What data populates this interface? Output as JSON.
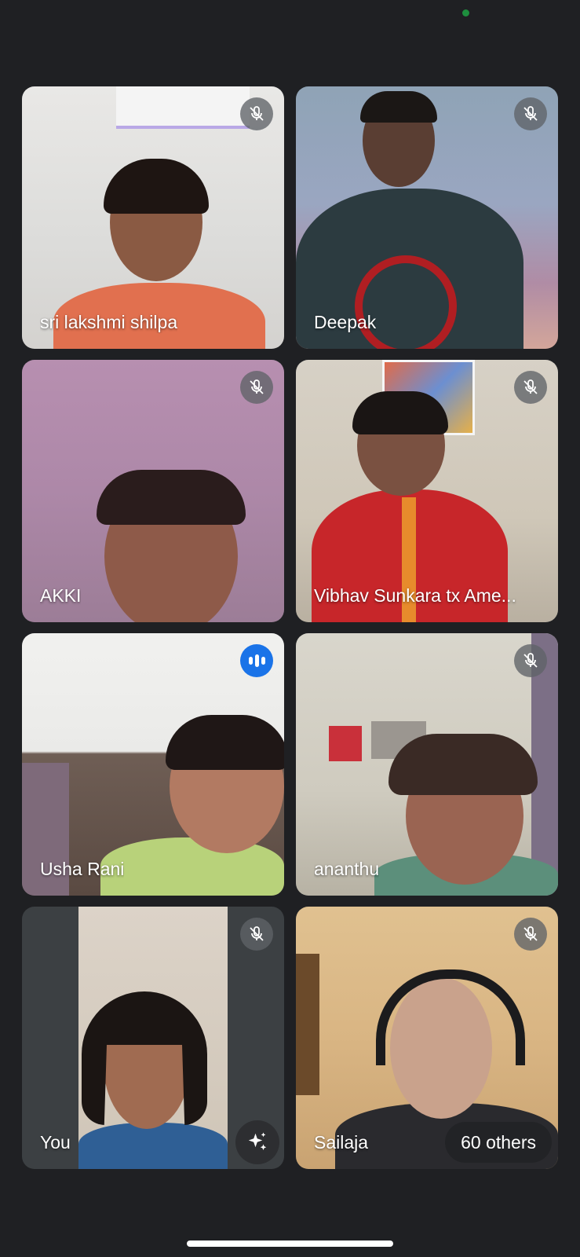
{
  "status": {
    "camera_indicator_color": "#1e8e3e"
  },
  "participants": [
    {
      "name": "sri lakshmi shilpa",
      "mic": "muted"
    },
    {
      "name": "Deepak",
      "mic": "muted"
    },
    {
      "name": "AKKI",
      "mic": "muted"
    },
    {
      "name": "Vibhav Sunkara tx Ame...",
      "mic": "muted"
    },
    {
      "name": "Usha Rani",
      "mic": "speaking"
    },
    {
      "name": "ananthu",
      "mic": "muted"
    },
    {
      "name": "You",
      "mic": "muted",
      "effects_icon": "sparkle-icon"
    },
    {
      "name": "Sailaja",
      "mic": "muted"
    }
  ],
  "others_count_label": "60 others",
  "icons": {
    "muted": "mic-off-icon",
    "speaking": "speaking-indicator-icon",
    "effects": "sparkle-icon"
  },
  "colors": {
    "background": "#202124",
    "speaking_accent": "#1a73e8",
    "muted_badge": "#5f6368"
  }
}
